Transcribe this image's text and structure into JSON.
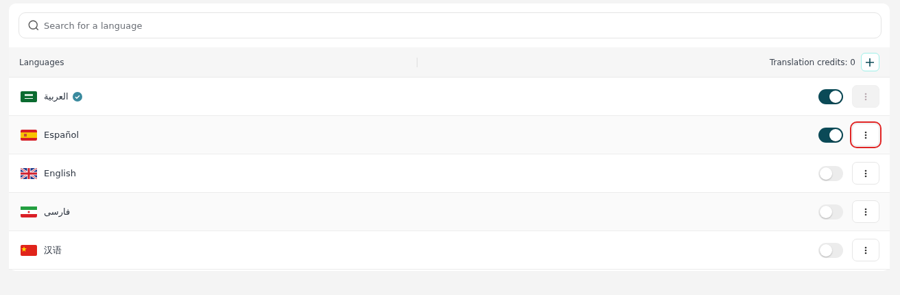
{
  "search": {
    "placeholder": "Search for a language"
  },
  "header": {
    "column_1": "Languages",
    "credits": "Translation credits: 0"
  },
  "languages": [
    {
      "name": "العربية",
      "kind": "sa",
      "verified": true,
      "on": true,
      "menu_disabled": true,
      "highlighted": false
    },
    {
      "name": "Español",
      "kind": "es",
      "verified": false,
      "on": true,
      "menu_disabled": false,
      "highlighted": true
    },
    {
      "name": "English",
      "kind": "gb",
      "verified": false,
      "on": false,
      "menu_disabled": false,
      "highlighted": false
    },
    {
      "name": "فارسی",
      "kind": "ir",
      "verified": false,
      "on": false,
      "menu_disabled": false,
      "highlighted": false
    },
    {
      "name": "汉语",
      "kind": "cn",
      "verified": false,
      "on": false,
      "menu_disabled": false,
      "highlighted": false
    }
  ]
}
